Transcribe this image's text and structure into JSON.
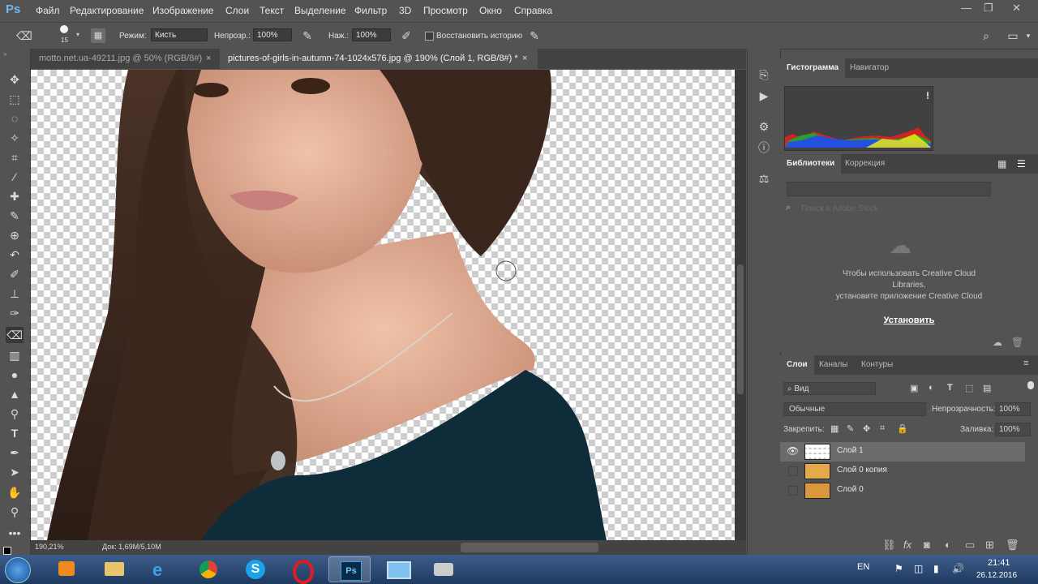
{
  "app": {
    "logo": "Ps"
  },
  "menu": [
    "Файл",
    "Редактирование",
    "Изображение",
    "Слои",
    "Текст",
    "Выделение",
    "Фильтр",
    "3D",
    "Просмотр",
    "Окно",
    "Справка"
  ],
  "window_controls": {
    "minimize": "—",
    "restore": "❐",
    "close": "✕"
  },
  "options": {
    "brush_size": "15",
    "mode_label": "Режим:",
    "mode_value": "Кисть",
    "opacity_label": "Непрозр.:",
    "opacity_value": "100%",
    "pressure_label": "Наж.:",
    "pressure_value": "100%",
    "restore_history": "Восстановить историю"
  },
  "tabs": [
    {
      "label": "motto.net.ua-49211.jpg @ 50% (RGB/8#)",
      "close": "×"
    },
    {
      "label": "pictures-of-girls-in-autumn-74-1024x576.jpg @ 190% (Слой 1, RGB/8#) *",
      "close": "×"
    }
  ],
  "status": {
    "zoom": "190,21%",
    "doc": "Док: 1,69M/5,10M"
  },
  "histogram_panel": {
    "tabs": [
      "Гистограмма",
      "Навигатор"
    ],
    "warning": "!"
  },
  "libraries_panel": {
    "tabs": [
      "Библиотеки",
      "Коррекция"
    ],
    "search_placeholder": "Поиск в Adobe Stock",
    "message_line1": "Чтобы использовать Creative Cloud",
    "message_line2": "Libraries,",
    "message_line3": "установите приложение Creative Cloud",
    "install_link": "Установить"
  },
  "layers_panel": {
    "tabs": [
      "Слои",
      "Каналы",
      "Контуры"
    ],
    "kind_filter": "Вид",
    "blend_mode": "Обычные",
    "opacity_label": "Непрозрачность:",
    "opacity_value": "100%",
    "lock_label": "Закрепить:",
    "fill_label": "Заливка:",
    "fill_value": "100%",
    "layers": [
      {
        "name": "Слой 1",
        "visible": true,
        "selected": true
      },
      {
        "name": "Слой 0 копия",
        "visible": false,
        "selected": false
      },
      {
        "name": "Слой 0",
        "visible": false,
        "selected": false
      }
    ]
  },
  "taskbar": {
    "apps": [
      "media-player",
      "explorer",
      "internet-explorer",
      "chrome",
      "skype",
      "opera",
      "photoshop",
      "computer",
      "camera"
    ],
    "lang": "EN",
    "time": "21:41",
    "date": "26.12.2016"
  }
}
